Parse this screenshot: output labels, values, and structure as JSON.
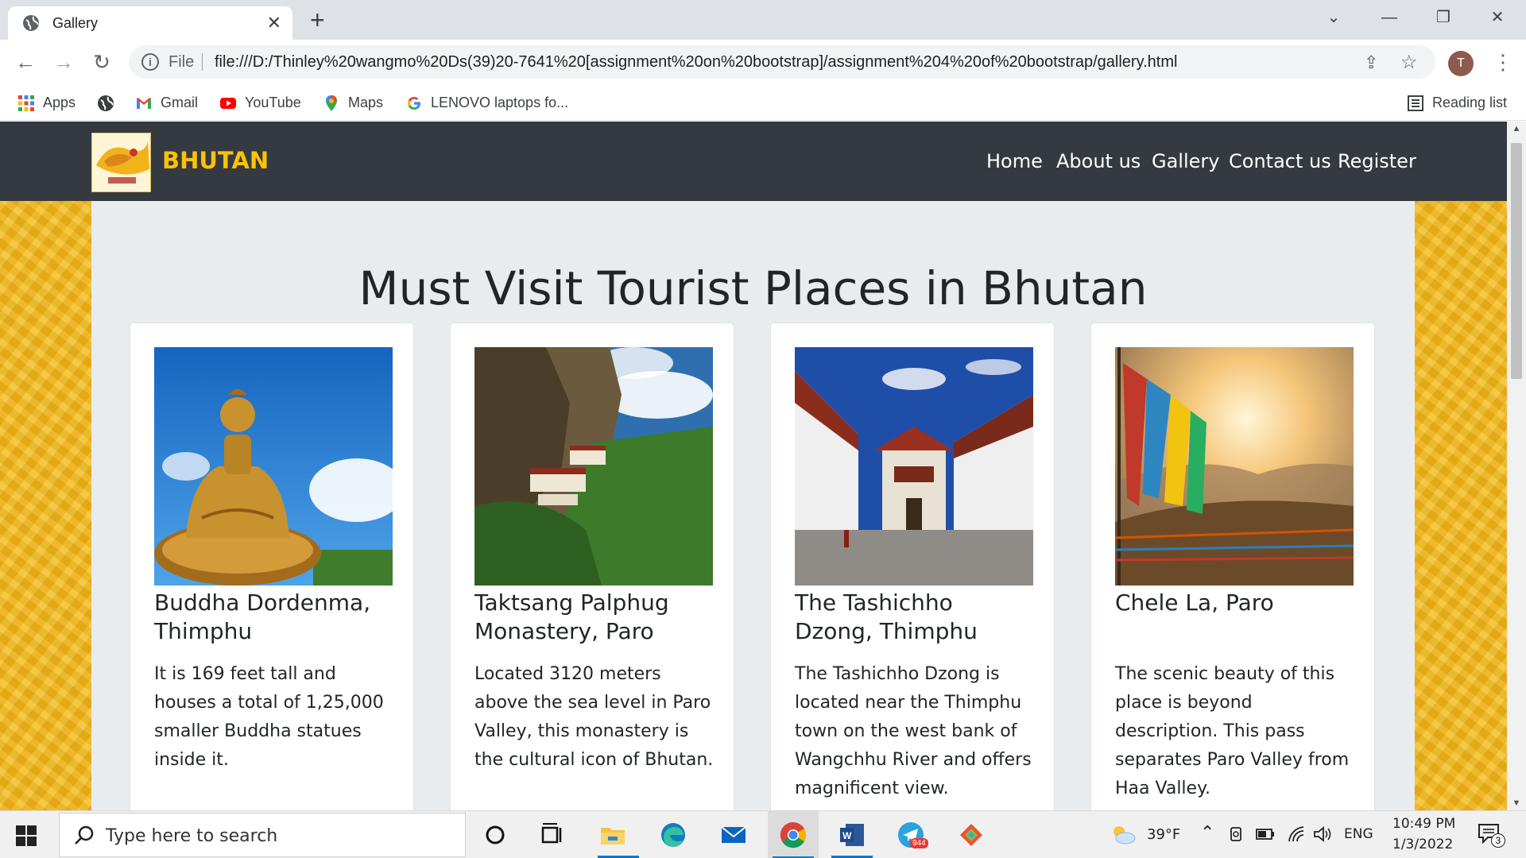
{
  "browser": {
    "tab_title": "Gallery",
    "tab_close_glyph": "✕",
    "new_tab_glyph": "+",
    "window_controls": [
      "⌄",
      "—",
      "❐",
      "✕"
    ],
    "back_glyph": "←",
    "forward_glyph": "→",
    "reload_glyph": "↻",
    "info_glyph": "i",
    "url_scheme": "File",
    "url": "file:///D:/Thinley%20wangmo%20Ds(39)20-7641%20[assignment%20on%20bootstrap]/assignment%204%20of%20bootstrap/gallery.html",
    "share_glyph": "⇪",
    "star_glyph": "☆",
    "profile_initial": "T",
    "menu_glyph": "⋮",
    "bookmarks": [
      {
        "label": "Apps",
        "icon": "apps-grid-icon"
      },
      {
        "label": "",
        "icon": "globe-icon"
      },
      {
        "label": "Gmail",
        "icon": "gmail-icon"
      },
      {
        "label": "YouTube",
        "icon": "youtube-icon"
      },
      {
        "label": "Maps",
        "icon": "maps-icon"
      },
      {
        "label": "LENOVO laptops fo...",
        "icon": "google-icon"
      }
    ],
    "reading_list": "Reading list"
  },
  "site": {
    "brand": "BHUTAN",
    "nav_links": [
      "Home",
      "About us",
      "Gallery",
      "Contact us",
      "Register"
    ],
    "heading": "Must Visit Tourist Places in Bhutan",
    "cards": [
      {
        "title": "Buddha Dordenma, Thimphu",
        "text": "It is 169 feet tall and houses a total of 1,25,000 smaller Buddha statues inside it."
      },
      {
        "title": "Taktsang Palphug Monastery, Paro",
        "text": "Located 3120 meters above the sea level in Paro Valley, this monastery is the cultural icon of Bhutan."
      },
      {
        "title": "The Tashichho Dzong, Thimphu",
        "text": "The Tashichho Dzong is located near the Thimphu town on the west bank of Wangchhu River and offers magnificent view."
      },
      {
        "title": "Chele La, Paro",
        "text": "The scenic beauty of this place is beyond description. This pass separates Paro Valley from Haa Valley."
      }
    ],
    "colors": {
      "navbar": "#343a40",
      "brand": "#ffc107",
      "background": "#f0b418",
      "container": "#e9ecef"
    }
  },
  "taskbar": {
    "search_placeholder": "Type here to search",
    "telegram_badge": "944",
    "weather": "39°F",
    "language": "ENG",
    "time": "10:49 PM",
    "date": "1/3/2022",
    "notification_count": "3"
  }
}
